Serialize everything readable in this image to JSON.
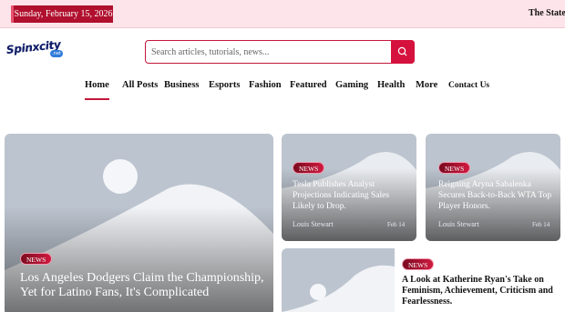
{
  "topbar": {
    "date": "Sunday, February 15, 2026",
    "ticker": "The State of"
  },
  "brand": {
    "logo_text": "Spinxcity",
    "logo_suffix": ".net"
  },
  "search": {
    "placeholder": "Search articles, tutorials, news..."
  },
  "nav": {
    "items": [
      "Home",
      "All Posts",
      "Business",
      "Esports",
      "Fashion",
      "Featured",
      "Gaming",
      "Health",
      "More",
      "Contact Us"
    ],
    "active": "Home"
  },
  "articles": [
    {
      "category": "NEWS",
      "title": "Los Angeles Dodgers Claim the Championship, Yet for Latino Fans, It's Complicated"
    },
    {
      "category": "NEWS",
      "title": "Tesla Publishes Analyst Projections Indicating Sales Likely to Drop.",
      "author": "Louis Stewart",
      "date": "Feb 14"
    },
    {
      "category": "NEWS",
      "title": "Reigning Aryna Sabalenka Secures Back-to-Back WTA Top Player Honors.",
      "author": "Louis Stewart",
      "date": "Feb 14"
    },
    {
      "category": "NEWS",
      "title": "A Look at Katherine Ryan's Take on Feminism, Achievement, Criticism and Fearlessness."
    }
  ],
  "colors": {
    "accent": "#c3173a",
    "topbar_bg": "#fde4ea",
    "placeholder_bg": "#bcc4cf"
  },
  "icons": {
    "search": "search-icon"
  }
}
